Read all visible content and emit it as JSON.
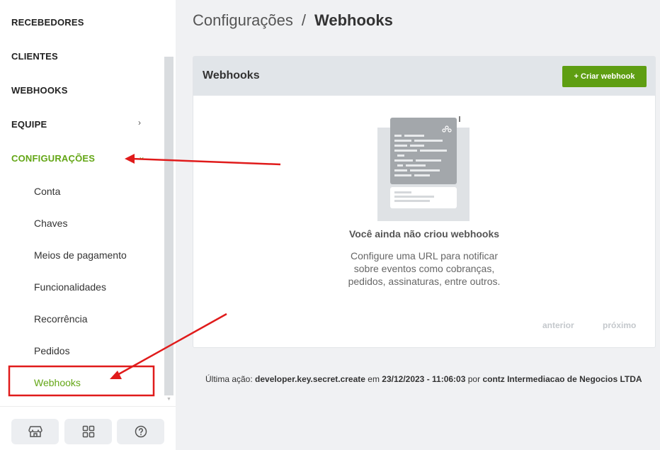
{
  "sidebar": {
    "top_items": [
      {
        "label": "RECEBEDORES"
      },
      {
        "label": "CLIENTES"
      },
      {
        "label": "WEBHOOKS"
      },
      {
        "label": "EQUIPE"
      },
      {
        "label": "CONFIGURAÇÕES"
      }
    ],
    "sub_items": [
      {
        "label": "Conta"
      },
      {
        "label": "Chaves"
      },
      {
        "label": "Meios de pagamento"
      },
      {
        "label": "Funcionalidades"
      },
      {
        "label": "Recorrência"
      },
      {
        "label": "Pedidos"
      },
      {
        "label": "Webhooks"
      }
    ],
    "bottom_icons": [
      "store-icon",
      "apps-grid-icon",
      "help-icon"
    ]
  },
  "breadcrumb": {
    "parent": "Configurações",
    "separator": "/",
    "current": "Webhooks"
  },
  "card": {
    "title": "Webhooks",
    "create_button": "+ Criar webhook",
    "empty_title": "Você ainda não criou webhooks",
    "empty_desc": [
      "Configure uma URL para notificar",
      "sobre eventos como cobranças,",
      "pedidos, assinaturas, entre outros."
    ],
    "pagination_prev": "anterior",
    "pagination_next": "próximo"
  },
  "last_action": {
    "prefix": "Última ação:",
    "action": "developer.key.secret.create",
    "on": "em",
    "datetime": "23/12/2023 - 11:06:03",
    "by": "por",
    "user": "contz Intermediacao de Negocios LTDA"
  },
  "colors": {
    "accent_green": "#63a615",
    "button_green": "#5e9e12",
    "annotation_red": "#e01b1b"
  }
}
